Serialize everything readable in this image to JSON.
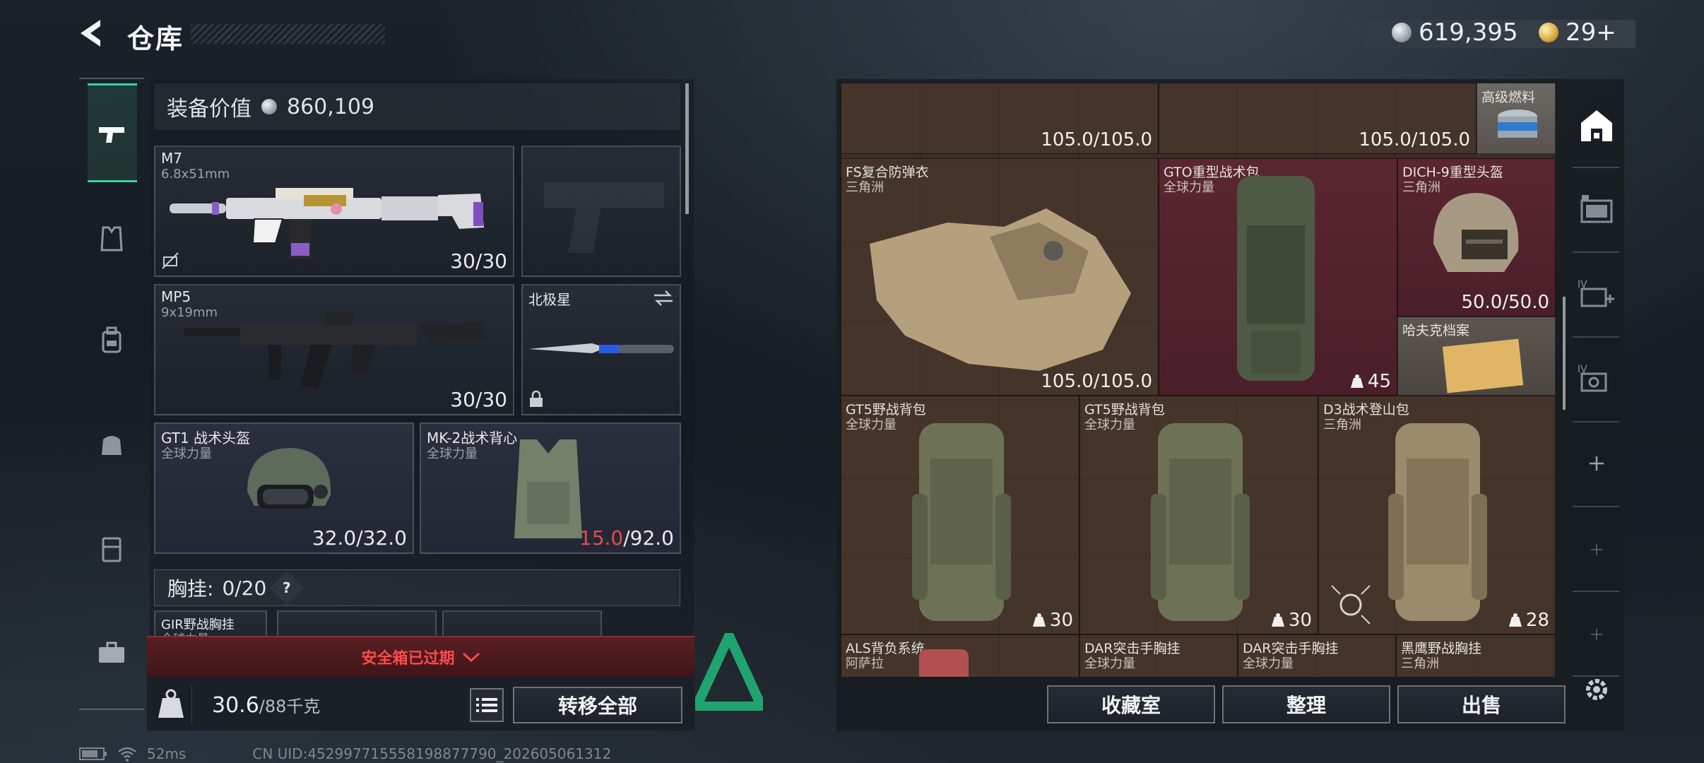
{
  "header": {
    "title": "仓库",
    "silver": "619,395",
    "gold": "29+"
  },
  "loadout": {
    "value_label": "装备价值",
    "value": "860,109",
    "slots": {
      "primary": {
        "name": "M7",
        "caliber": "6.8x51mm",
        "qty": "30/30"
      },
      "pistol": {
        "name": "",
        "qty": ""
      },
      "secondary": {
        "name": "MP5",
        "caliber": "9x19mm",
        "qty": "30/30"
      },
      "melee": {
        "name": "北极星"
      },
      "helmet": {
        "name": "GT1 战术头盔",
        "faction": "全球力量",
        "qty": "32.0/32.0"
      },
      "armor": {
        "name": "MK-2战术背心",
        "faction": "全球力量",
        "qty_current": "15.0",
        "qty_max": "/92.0"
      }
    },
    "chest_rig_label": "胸挂:",
    "chest_rig_value": "0/20",
    "chest_rig_item": {
      "name": "GIR野战胸挂",
      "faction": "全球力量"
    },
    "safe_box_text": "安全箱已过期",
    "weight_value": "30.6",
    "weight_max": "/88千克",
    "transfer_all": "转移全部"
  },
  "warehouse": {
    "cells": [
      {
        "qty": "105.0/105.0"
      },
      {
        "qty": "105.0/105.0"
      },
      {
        "name": "高级燃料"
      },
      {
        "name": "FS复合防弹衣",
        "faction": "三角洲",
        "qty": "105.0/105.0"
      },
      {
        "name": "GTO重型战术包",
        "faction": "全球力量",
        "count": "45"
      },
      {
        "name": "DICH-9重型头盔",
        "faction": "三角洲",
        "qty": "50.0/50.0"
      },
      {
        "name": "哈夫克档案"
      },
      {
        "name": "GT5野战背包",
        "faction": "全球力量",
        "count": "30"
      },
      {
        "name": "GT5野战背包",
        "faction": "全球力量",
        "count": "30"
      },
      {
        "name": "D3战术登山包",
        "faction": "三角洲",
        "count": "28"
      },
      {
        "name": "ALS背负系统",
        "faction": "阿萨拉"
      },
      {
        "name": "DAR突击手胸挂",
        "faction": "全球力量"
      },
      {
        "name": "DAR突击手胸挂",
        "faction": "全球力量"
      },
      {
        "name": "黑鹰野战胸挂",
        "faction": "三角洲"
      }
    ],
    "buttons": {
      "collection": "收藏室",
      "organize": "整理",
      "sell": "出售"
    }
  },
  "status_bar": {
    "ping": "52ms",
    "uid": "CN UID:452997715558198877790_202605061312"
  },
  "colors": {
    "accent_green": "#36d39a",
    "warning_red": "#e04b4b",
    "gear_bg_red": "#5a2631"
  },
  "icons": [
    "back-arrow-icon",
    "silver-coin-icon",
    "gold-coin-icon",
    "gun-icon",
    "armor-icon",
    "backpack-icon",
    "bag-icon",
    "case-icon",
    "toolbox-icon",
    "lock-icon",
    "swap-icon",
    "weight-icon",
    "list-icon",
    "home-icon",
    "settings-icon",
    "plus-icon"
  ]
}
